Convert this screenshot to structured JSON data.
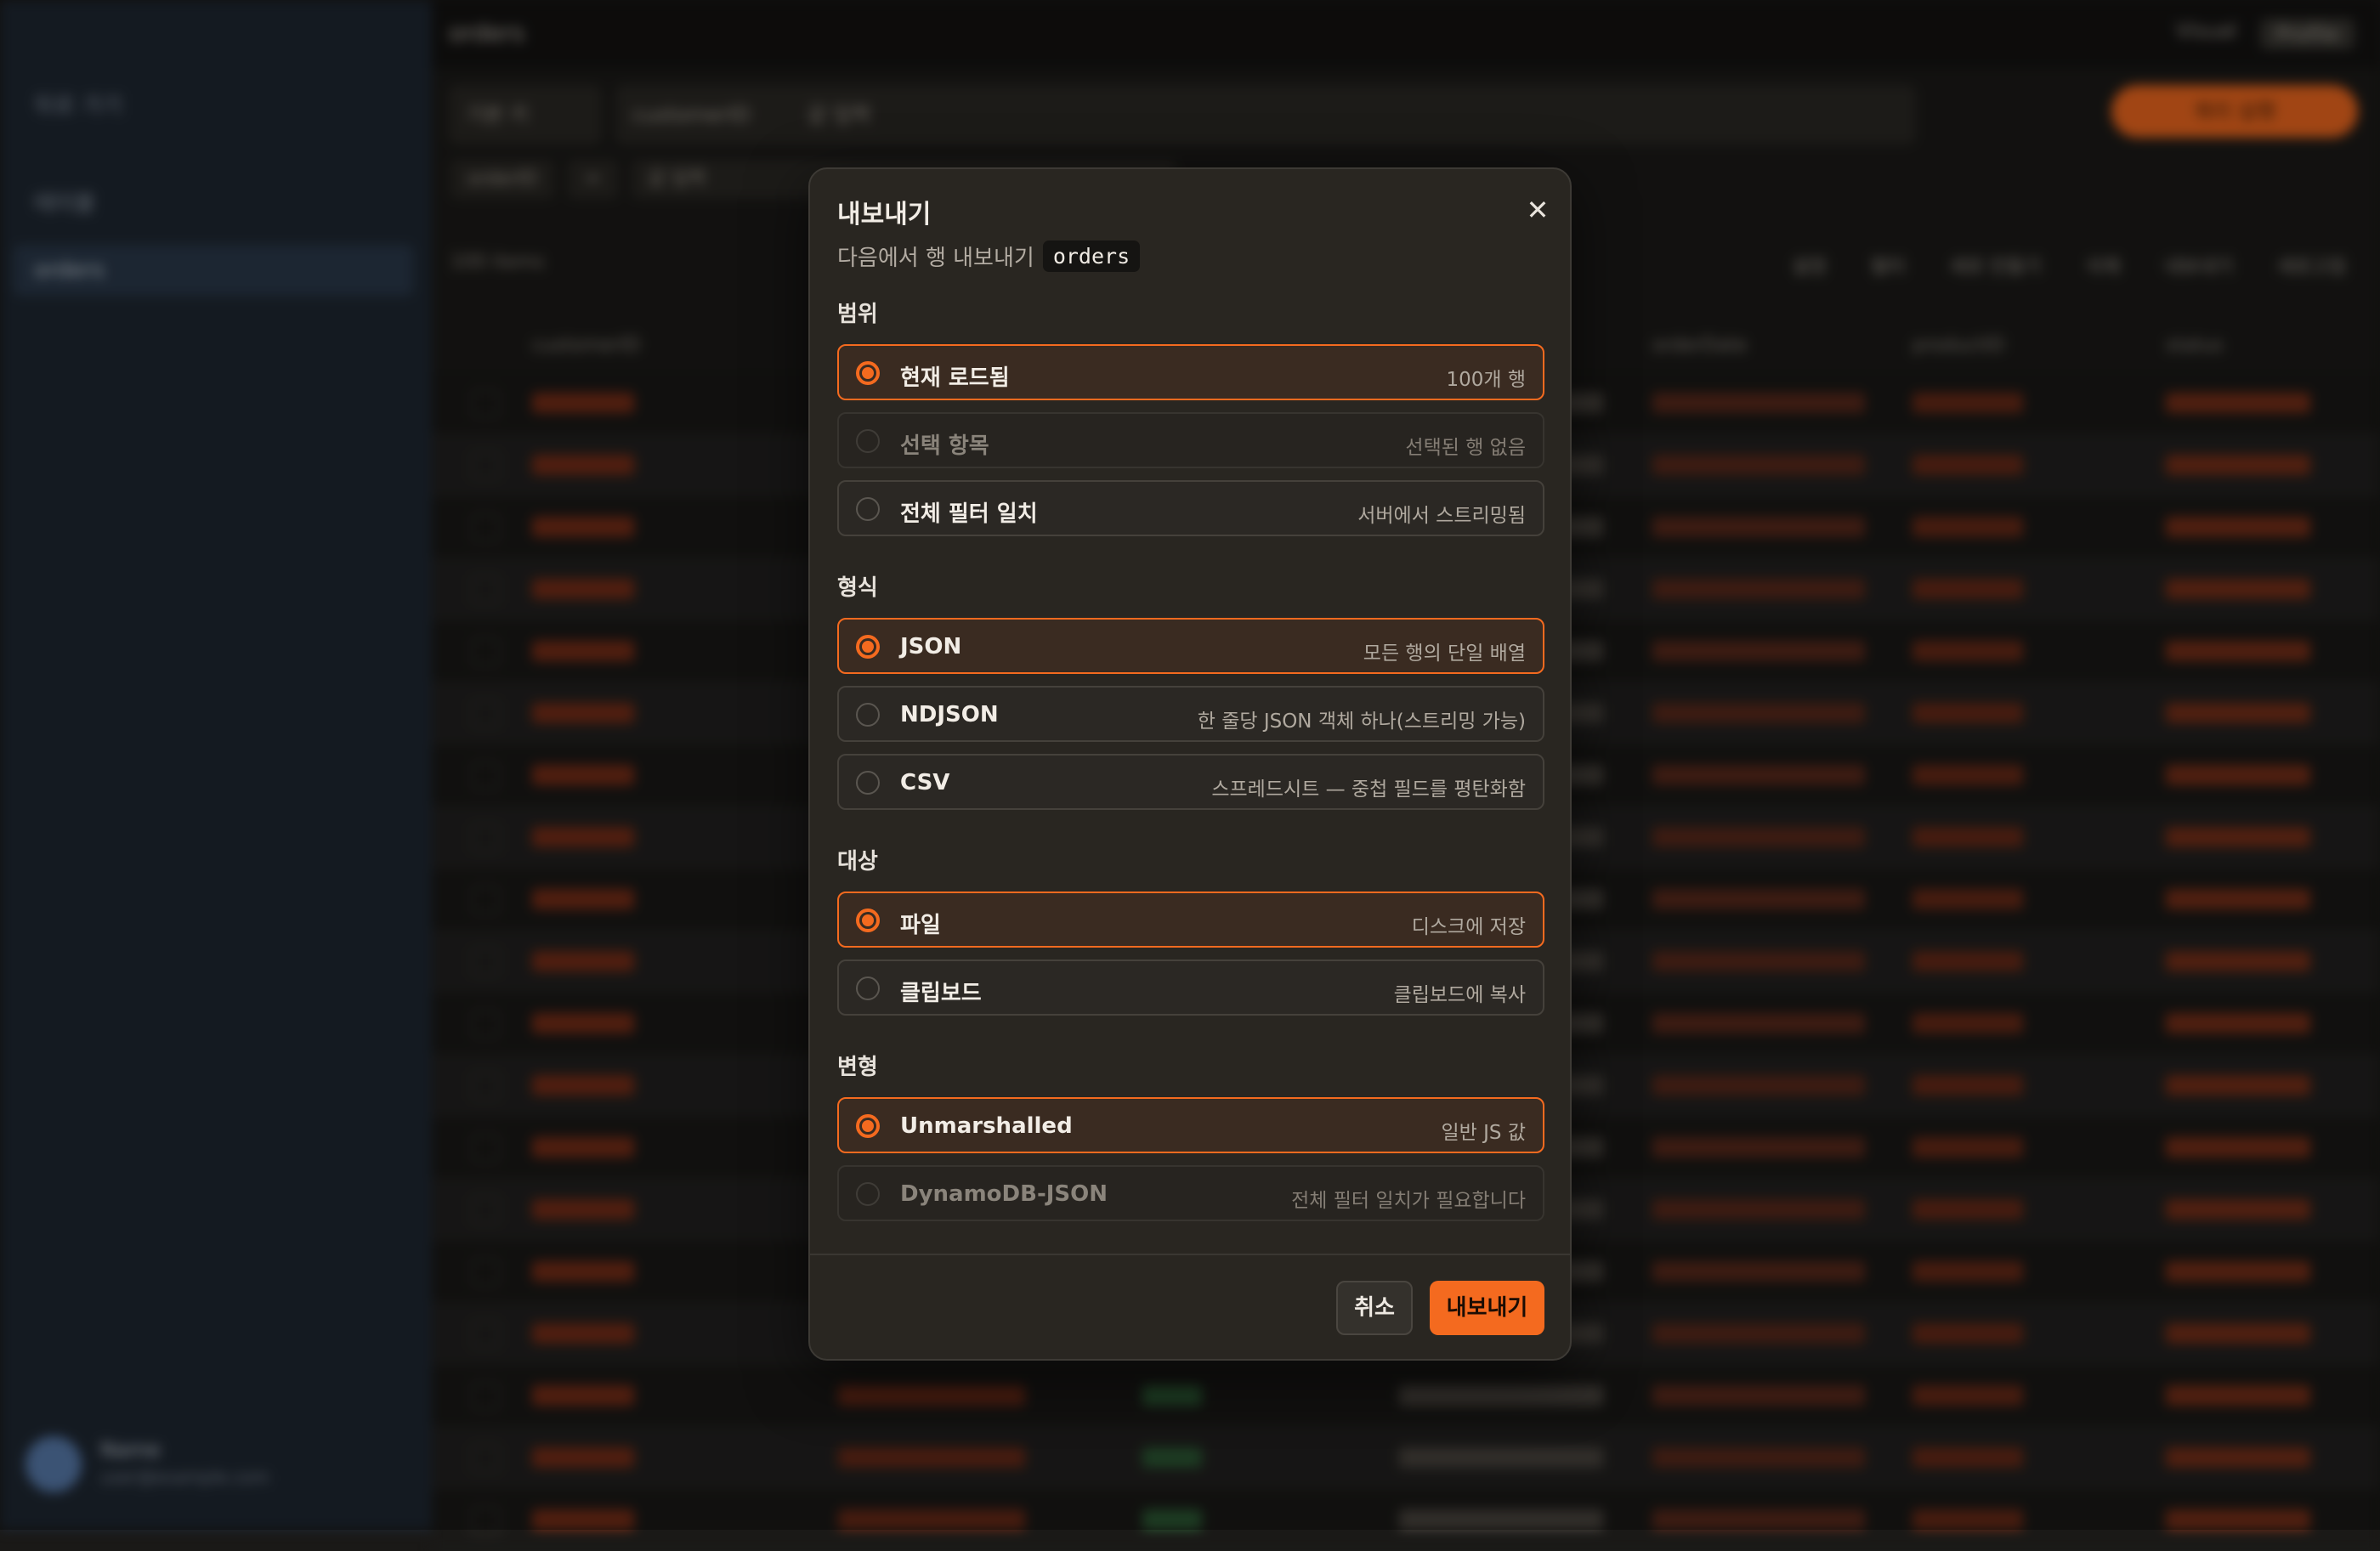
{
  "background": {
    "sidebar": {
      "back_label": "뒤로 가기",
      "items": [
        {
          "label": "테이블"
        },
        {
          "label": "orders"
        }
      ],
      "user": {
        "name": "Name",
        "email": "user@example.com"
      }
    },
    "topbar": {
      "title": "orders",
      "right_items": [
        "Visual",
        "Profile"
      ]
    },
    "toolbar": {
      "segments": [
        "기본 키",
        "customerID",
        "값 입력"
      ],
      "query_label": "쿼리 실행"
    },
    "filter_chips": [
      "orderID",
      "= ",
      "값 입력"
    ],
    "count_label": "100 items",
    "actions": [
      "설정",
      "필터",
      "새로 만들기",
      "삭제",
      "내보내기",
      "새로고침"
    ],
    "column_headers": [
      "customerID",
      "orderDate",
      "productID",
      "status"
    ]
  },
  "modal": {
    "title": "내보내기",
    "subtitle": "다음에서 행 내보내기",
    "table_name": "orders",
    "close_glyph": "✕",
    "sections": [
      {
        "label": "범위",
        "options": [
          {
            "label": "현재 로드됨",
            "desc": "100개 행"
          },
          {
            "label": "선택 항목",
            "desc": "선택된 행 없음"
          },
          {
            "label": "전체 필터 일치",
            "desc": "서버에서 스트리밍됨"
          }
        ]
      },
      {
        "label": "형식",
        "options": [
          {
            "label": "JSON",
            "desc": "모든 행의 단일 배열"
          },
          {
            "label": "NDJSON",
            "desc": "한 줄당 JSON 객체 하나(스트리밍 가능)"
          },
          {
            "label": "CSV",
            "desc": "스프레드시트 — 중첩 필드를 평탄화함"
          }
        ]
      },
      {
        "label": "대상",
        "options": [
          {
            "label": "파일",
            "desc": "디스크에 저장"
          },
          {
            "label": "클립보드",
            "desc": "클립보드에 복사"
          }
        ]
      },
      {
        "label": "변형",
        "options": [
          {
            "label": "Unmarshalled",
            "desc": "일반 JS 값"
          },
          {
            "label": "DynamoDB-JSON",
            "desc": "전체 필터 일치가 필요합니다"
          }
        ]
      }
    ],
    "cancel_label": "취소",
    "export_label": "내보내기"
  },
  "colors": {
    "accent": "#f46a1f",
    "modal_bg": "#292621",
    "sidebar_bg": "#1f2833"
  }
}
